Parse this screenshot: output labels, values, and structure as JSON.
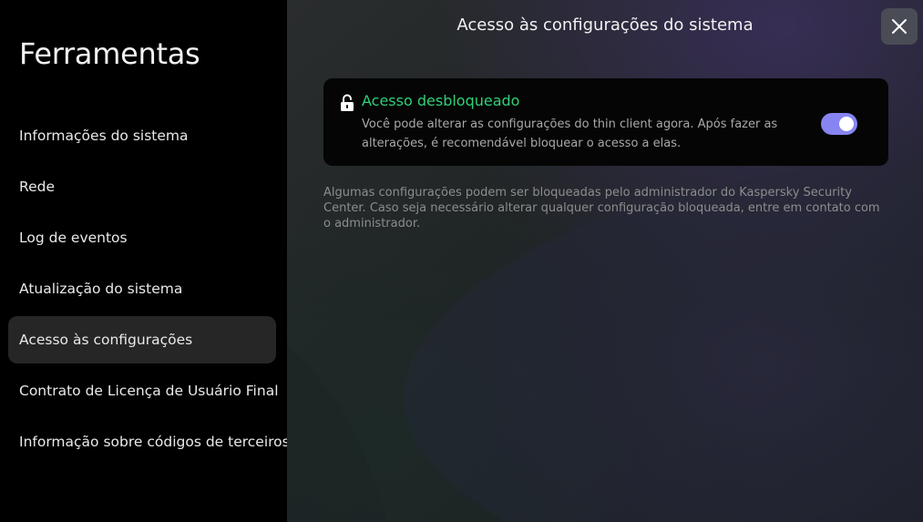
{
  "sidebar": {
    "title": "Ferramentas",
    "items": [
      {
        "label": "Informações do sistema"
      },
      {
        "label": "Rede"
      },
      {
        "label": "Log de eventos"
      },
      {
        "label": "Atualização do sistema"
      },
      {
        "label": "Acesso às configurações",
        "active": true
      },
      {
        "label": "Contrato de Licença de Usuário Final"
      },
      {
        "label": "Informação sobre códigos de terceiros"
      }
    ]
  },
  "header": {
    "title": "Acesso às configurações do sistema",
    "close_icon": "close-icon"
  },
  "access_card": {
    "icon": "unlock-icon",
    "title": "Acesso desbloqueado",
    "description": "Você pode alterar as configurações do thin client agora. Após fazer as alterações, é recomendável bloquear o acesso a elas.",
    "toggle_on": true
  },
  "note": "Algumas configurações podem ser bloqueadas pelo administrador do Kaspersky Security Center. Caso seja necessário alterar qualquer configuração bloqueada, entre em contato com o administrador.",
  "colors": {
    "accent_green": "#2fd17a",
    "toggle_purple": "#8785f2",
    "active_item_bg": "#262626",
    "close_button_bg": "#4a4c55"
  }
}
